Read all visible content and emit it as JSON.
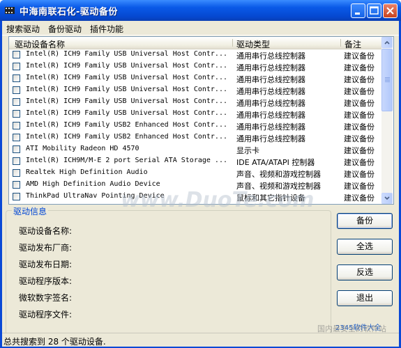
{
  "window": {
    "title": "中海南联石化-驱动备份",
    "icon": "film-app-icon",
    "colors": {
      "titlebar": "#0a5ae8",
      "accent": "#0046d5",
      "close": "#c9431f"
    }
  },
  "menu": [
    {
      "label": "搜索驱动"
    },
    {
      "label": "备份驱动"
    },
    {
      "label": "插件功能"
    }
  ],
  "list": {
    "columns": [
      "驱动设备名称",
      "驱动类型",
      "备注"
    ],
    "rows": [
      {
        "name": "Intel(R) ICH9 Family USB Universal Host Contr...",
        "type": "通用串行总线控制器",
        "note": "建议备份"
      },
      {
        "name": "Intel(R) ICH9 Family USB Universal Host Contr...",
        "type": "通用串行总线控制器",
        "note": "建议备份"
      },
      {
        "name": "Intel(R) ICH9 Family USB Universal Host Contr...",
        "type": "通用串行总线控制器",
        "note": "建议备份"
      },
      {
        "name": "Intel(R) ICH9 Family USB Universal Host Contr...",
        "type": "通用串行总线控制器",
        "note": "建议备份"
      },
      {
        "name": "Intel(R) ICH9 Family USB Universal Host Contr...",
        "type": "通用串行总线控制器",
        "note": "建议备份"
      },
      {
        "name": "Intel(R) ICH9 Family USB Universal Host Contr...",
        "type": "通用串行总线控制器",
        "note": "建议备份"
      },
      {
        "name": "Intel(R) ICH9 Family USB2 Enhanced Host Contr...",
        "type": "通用串行总线控制器",
        "note": "建议备份"
      },
      {
        "name": "Intel(R) ICH9 Family USB2 Enhanced Host Contr...",
        "type": "通用串行总线控制器",
        "note": "建议备份"
      },
      {
        "name": "ATI Mobility Radeon HD 4570",
        "type": "显示卡",
        "note": "建议备份"
      },
      {
        "name": "Intel(R) ICH9M/M-E 2 port Serial ATA Storage ...",
        "type": "IDE ATA/ATAPI 控制器",
        "note": "建议备份"
      },
      {
        "name": "Realtek High Definition Audio",
        "type": "声音、视频和游戏控制器",
        "note": "建议备份"
      },
      {
        "name": "AMD High Definition Audio Device",
        "type": "声音、视频和游戏控制器",
        "note": "建议备份"
      },
      {
        "name": "ThinkPad UltraNav Pointing Device",
        "type": "鼠标和其它指针设备",
        "note": "建议备份"
      }
    ]
  },
  "info": {
    "group_title": "驱动信息",
    "labels": [
      "驱动设备名称:",
      "驱动发布厂商:",
      "驱动发布日期:",
      "驱动程序版本:",
      "微软数字签名:",
      "驱动程序文件:"
    ]
  },
  "buttons": {
    "backup": "备份",
    "select_all": "全选",
    "invert": "反选",
    "exit": "退出"
  },
  "status": {
    "text": "总共搜索到 28 个驱动设备."
  },
  "watermarks": {
    "main": "www.DuoTe.com",
    "corner": "2345软件大全 www.DuoTe.com",
    "bottom": "国内最安全的软件站"
  }
}
